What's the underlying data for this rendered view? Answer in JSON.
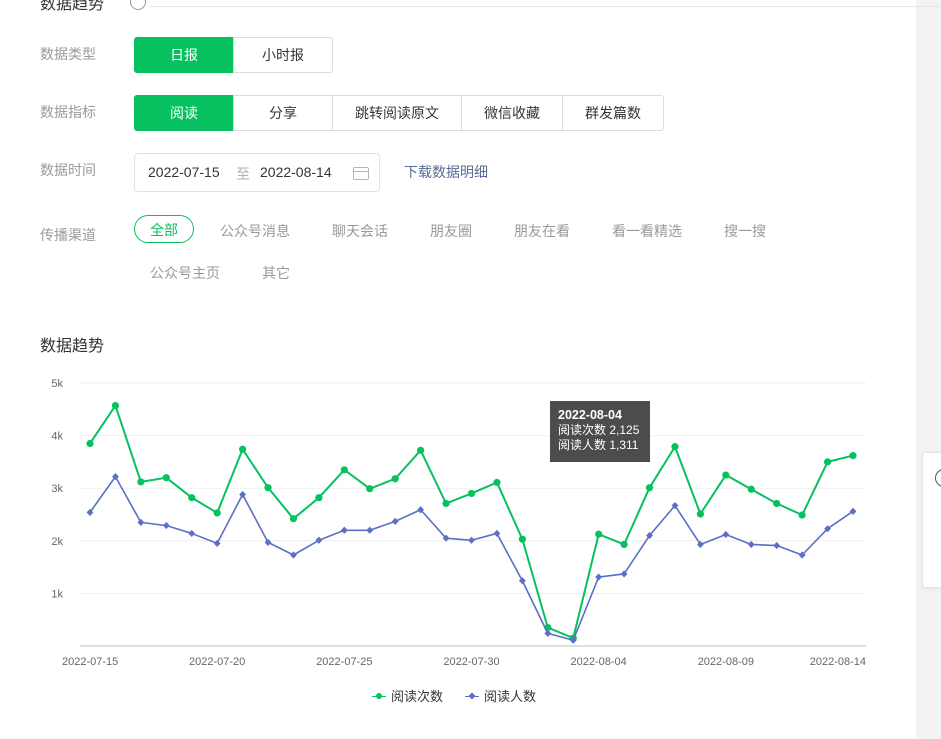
{
  "top": {
    "partial_title": "数据趋势"
  },
  "filters": {
    "data_type": {
      "label": "数据类型",
      "options": [
        "日报",
        "小时报"
      ],
      "selected": "日报"
    },
    "data_metric": {
      "label": "数据指标",
      "options": [
        "阅读",
        "分享",
        "跳转阅读原文",
        "微信收藏",
        "群发篇数"
      ],
      "selected": "阅读"
    },
    "data_time": {
      "label": "数据时间",
      "start": "2022-07-15",
      "separator": "至",
      "end": "2022-08-14",
      "download_label": "下载数据明细"
    },
    "channel": {
      "label": "传播渠道",
      "options": [
        "全部",
        "公众号消息",
        "聊天会话",
        "朋友圈",
        "朋友在看",
        "看一看精选",
        "搜一搜",
        "公众号主页",
        "其它"
      ],
      "selected": "全部"
    }
  },
  "chart_section": {
    "title": "数据趋势"
  },
  "tooltip": {
    "date": "2022-08-04",
    "line1": "阅读次数 2,125",
    "line2": "阅读人数 1,311"
  },
  "colors": {
    "accent": "#07c160",
    "series2": "#5b6fc6",
    "link": "#576b95"
  },
  "chart_data": {
    "type": "line",
    "x": [
      "2022-07-15",
      "2022-07-16",
      "2022-07-17",
      "2022-07-18",
      "2022-07-19",
      "2022-07-20",
      "2022-07-21",
      "2022-07-22",
      "2022-07-23",
      "2022-07-24",
      "2022-07-25",
      "2022-07-26",
      "2022-07-27",
      "2022-07-28",
      "2022-07-29",
      "2022-07-30",
      "2022-07-31",
      "2022-08-01",
      "2022-08-02",
      "2022-08-03",
      "2022-08-04",
      "2022-08-05",
      "2022-08-06",
      "2022-08-07",
      "2022-08-08",
      "2022-08-09",
      "2022-08-10",
      "2022-08-11",
      "2022-08-12",
      "2022-08-13",
      "2022-08-14"
    ],
    "x_tick_labels": [
      "2022-07-15",
      "2022-07-20",
      "2022-07-25",
      "2022-07-30",
      "2022-08-04",
      "2022-08-09",
      "2022-08-14"
    ],
    "y_tick_labels": [
      "1k",
      "2k",
      "3k",
      "4k",
      "5k"
    ],
    "ylim": [
      0,
      5000
    ],
    "grid": true,
    "legend_position": "bottom",
    "series": [
      {
        "name": "阅读次数",
        "marker": "circle",
        "color": "#07c160",
        "values": [
          3850,
          4570,
          3120,
          3200,
          2820,
          2530,
          3740,
          3010,
          2420,
          2820,
          3350,
          2990,
          3180,
          3720,
          2710,
          2900,
          3110,
          2030,
          350,
          150,
          2125,
          1930,
          3010,
          3790,
          2510,
          3250,
          2980,
          2710,
          2490,
          3500,
          3620
        ]
      },
      {
        "name": "阅读人数",
        "marker": "diamond",
        "color": "#5b6fc6",
        "values": [
          2540,
          3220,
          2350,
          2290,
          2140,
          1950,
          2880,
          1970,
          1730,
          2010,
          2200,
          2200,
          2370,
          2590,
          2050,
          2010,
          2140,
          1240,
          240,
          110,
          1311,
          1370,
          2100,
          2670,
          1930,
          2120,
          1930,
          1910,
          1730,
          2230,
          2560
        ]
      }
    ]
  }
}
